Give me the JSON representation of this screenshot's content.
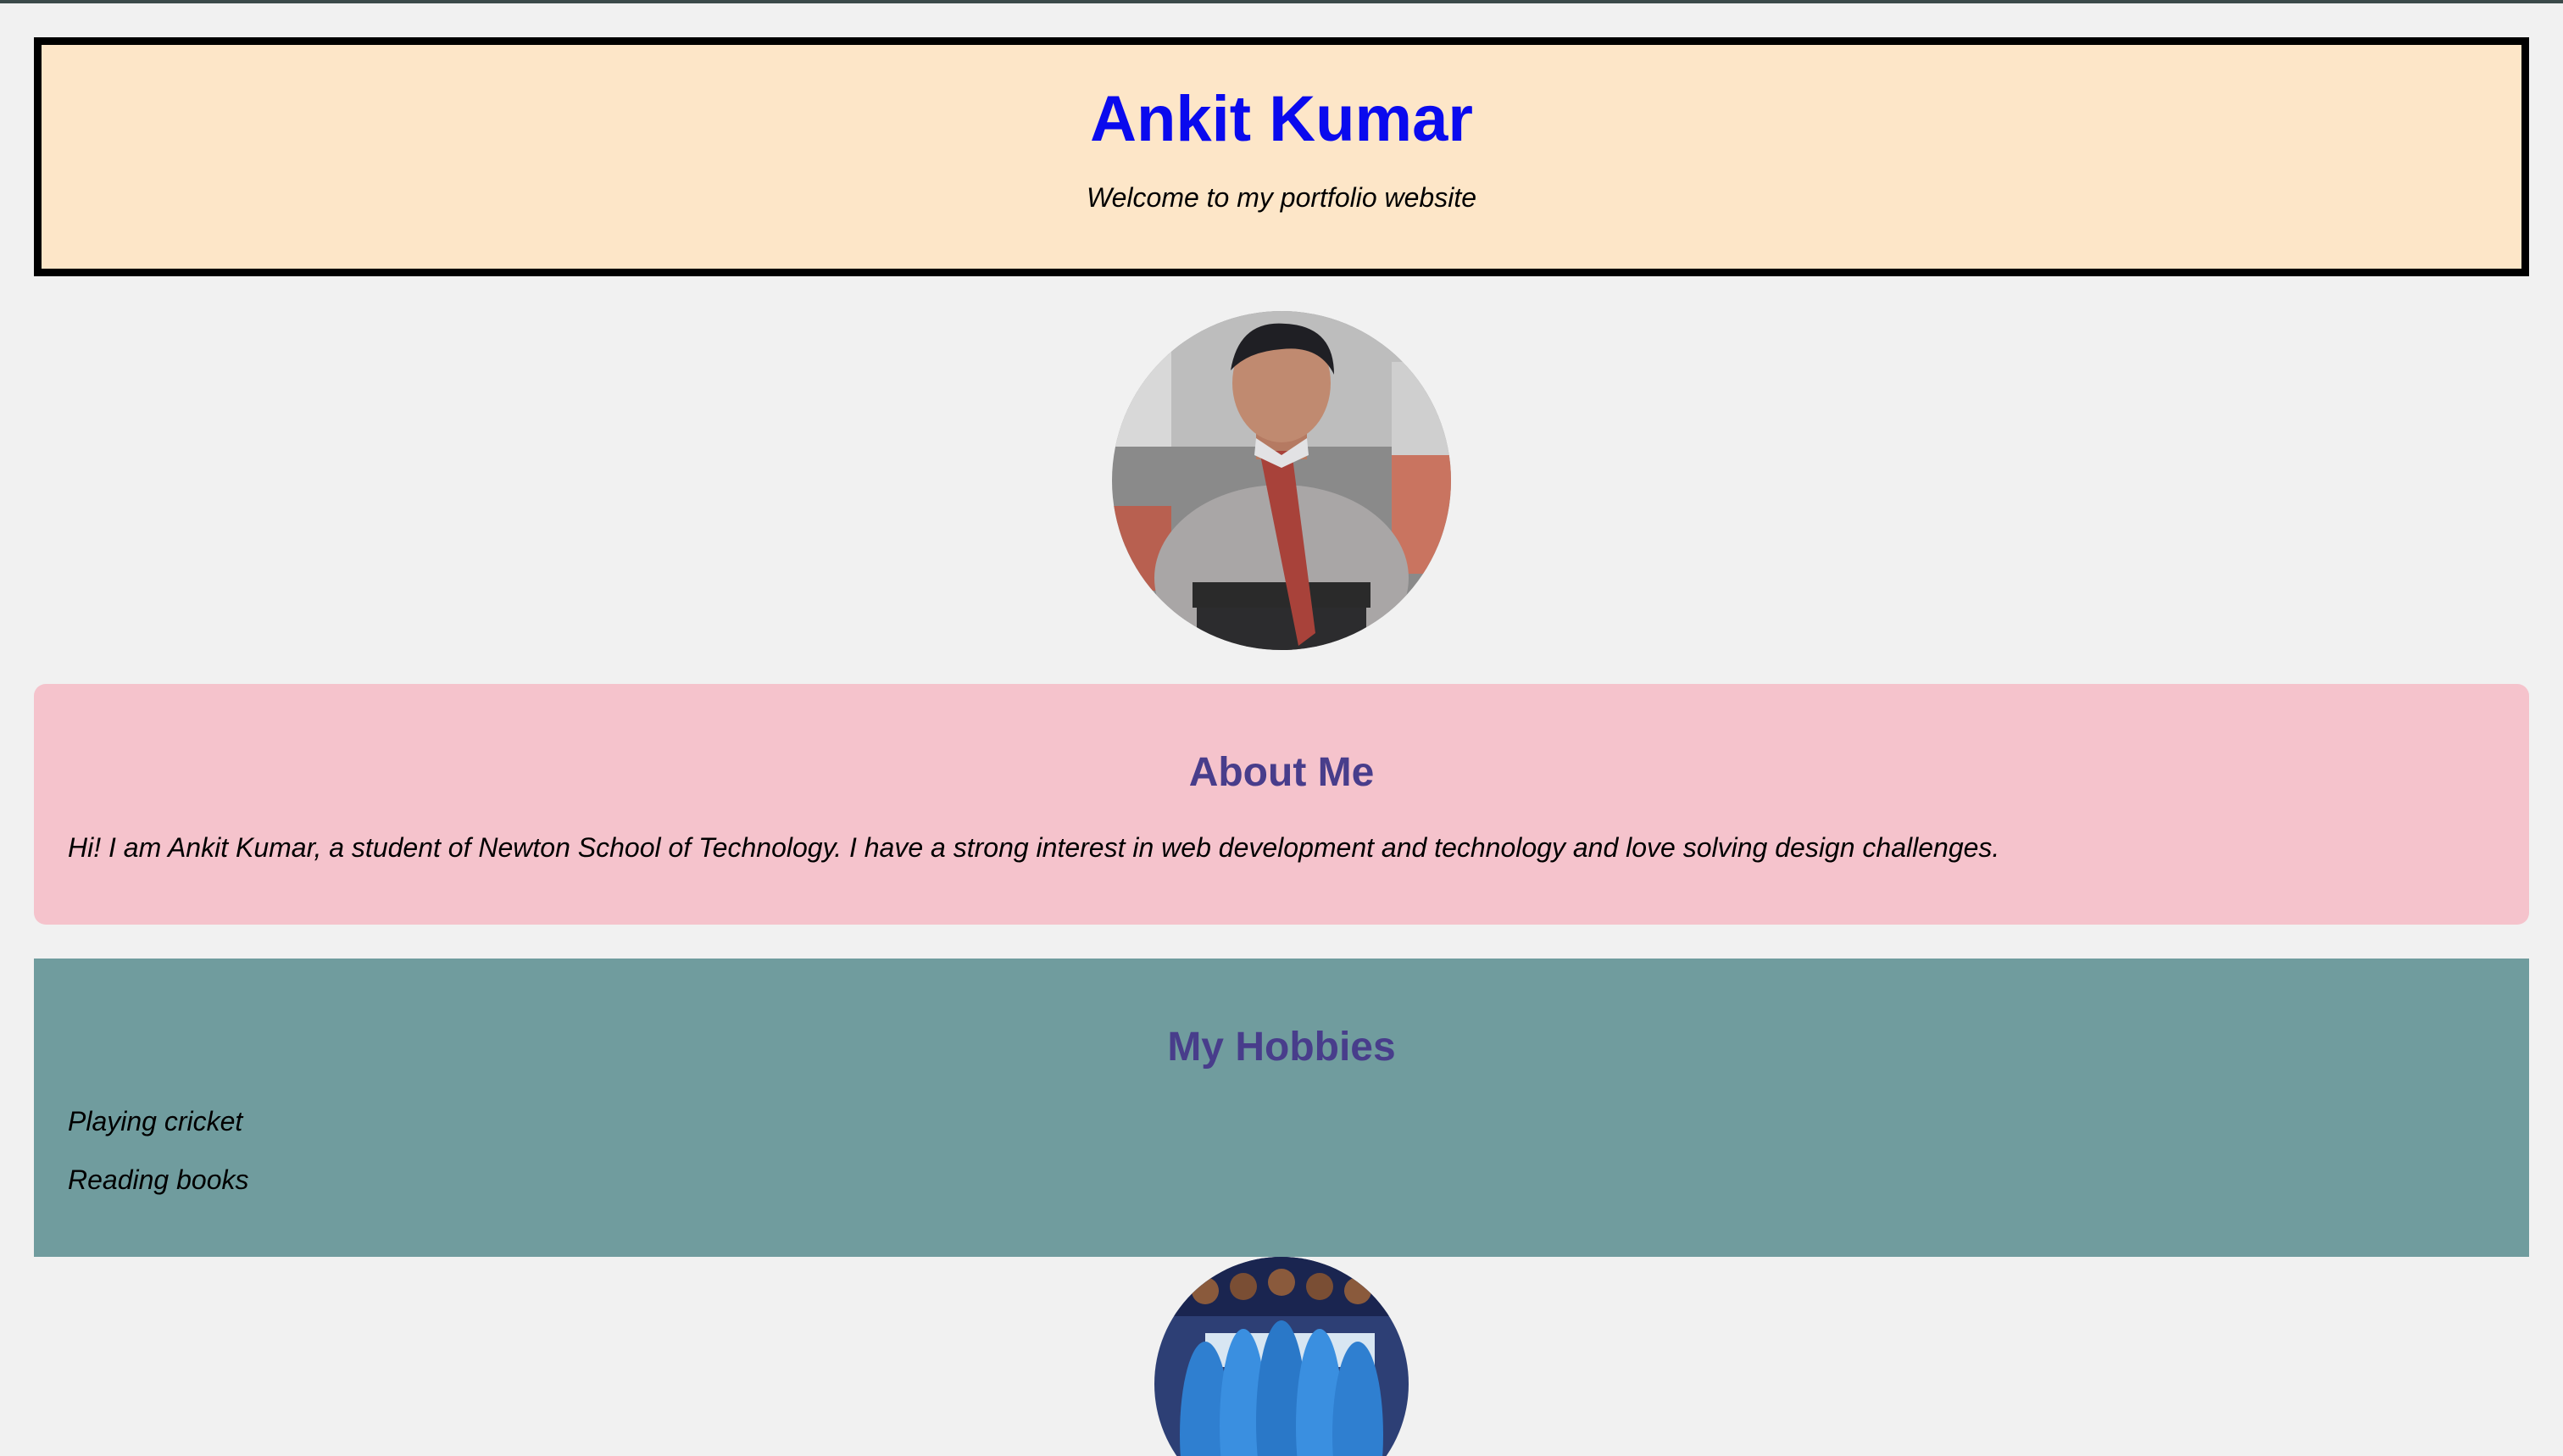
{
  "header": {
    "name": "Ankit Kumar",
    "tagline": "Welcome to my portfolio website"
  },
  "about": {
    "heading": "About Me",
    "text": "Hi! I am Ankit Kumar, a student of Newton School of Technology. I have a strong interest in web development and technology and love solving design challenges."
  },
  "hobbies": {
    "heading": "My Hobbies",
    "items": [
      "Playing cricket",
      "Reading books"
    ]
  },
  "colors": {
    "page_background": "#f1f1f1",
    "header_background": "#fde6c8",
    "name_color": "#0a0aee",
    "about_background": "#f5c3cc",
    "section_heading_color": "#483d8b",
    "hobbies_background": "#709c9e"
  }
}
